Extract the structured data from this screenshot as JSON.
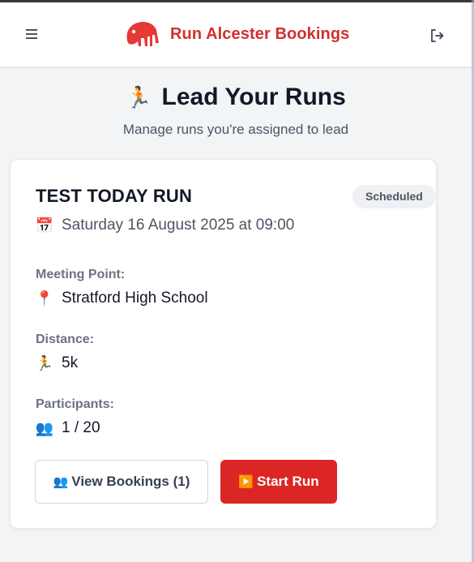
{
  "header": {
    "brand": "Run Alcester Bookings",
    "menu_icon": "hamburger-menu-icon",
    "logout_icon": "logout-icon"
  },
  "page": {
    "title_emoji": "🏃",
    "title": "Lead Your Runs",
    "subtitle": "Manage runs you're assigned to lead"
  },
  "run": {
    "name": "TEST TODAY RUN",
    "status": "Scheduled",
    "date_emoji": "📅",
    "date": "Saturday 16 August 2025 at 09:00",
    "meeting_label": "Meeting Point:",
    "meeting_emoji": "📍",
    "meeting_point": "Stratford High School",
    "distance_label": "Distance:",
    "distance_emoji": "🏃",
    "distance": "5k",
    "participants_label": "Participants:",
    "participants_emoji": "👥",
    "participants": "1 / 20",
    "view_bookings_emoji": "👥",
    "view_bookings": "View Bookings (1)",
    "start_emoji": "▶️",
    "start_run": "Start Run"
  },
  "colors": {
    "brand_red": "#d32f2f",
    "button_red": "#dc2626",
    "badge_bg": "#eef0f3"
  }
}
